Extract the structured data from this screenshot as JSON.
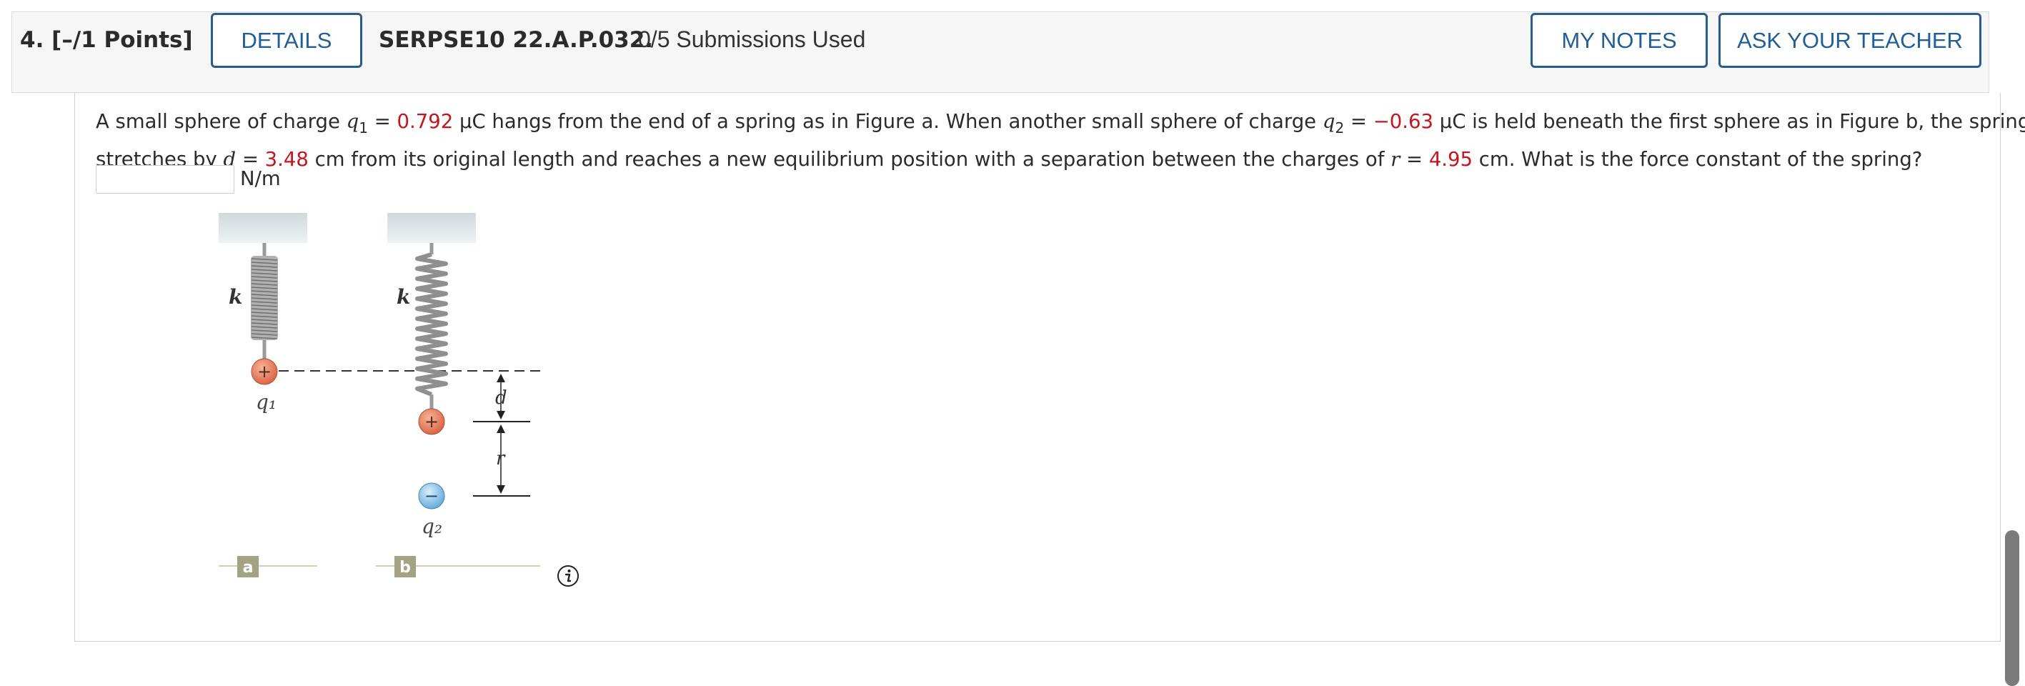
{
  "question": {
    "number": "4.",
    "points": "[–/1 Points]",
    "details_label": "DETAILS",
    "code": "SERPSE10 22.A.P.032.",
    "submissions": "0/5 Submissions Used",
    "my_notes_label": "MY NOTES",
    "ask_teacher_label": "ASK YOUR TEACHER"
  },
  "problem": {
    "t1": "A small sphere of charge ",
    "q1_var": "q",
    "q1_sub": "1",
    "eq1": " = ",
    "q1_value": "0.792",
    "t2": " μC hangs from the end of a spring as in Figure a. When another small sphere of charge ",
    "q2_var": "q",
    "q2_sub": "2",
    "eq2": " = ",
    "q2_value": "−0.63",
    "t3": " μC is held beneath the first sphere as in Figure b, the spring",
    "t4": "stretches by ",
    "d_var": "d",
    "eq3": " = ",
    "d_value": "3.48",
    "t5": " cm from its original length and reaches a new equilibrium position with a separation between the charges of ",
    "r_var": "r",
    "eq4": " = ",
    "r_value": "4.95",
    "t6": " cm. What is the force constant of the spring?"
  },
  "answer": {
    "value": "",
    "units": "N/m"
  },
  "figure": {
    "label_k_a": "k",
    "label_k_b": "k",
    "label_q1": "q₁",
    "label_q2": "q₂",
    "label_d": "d",
    "label_r": "r",
    "plus_sign": "+",
    "minus_sign": "−",
    "panel_a": "a",
    "panel_b": "b"
  },
  "icons": {
    "info": "info-icon"
  },
  "colors": {
    "red_values": "#c4161c",
    "button_border": "#2a5d8f",
    "positive_charge": "#e07050",
    "negative_charge": "#7ab8e0"
  }
}
